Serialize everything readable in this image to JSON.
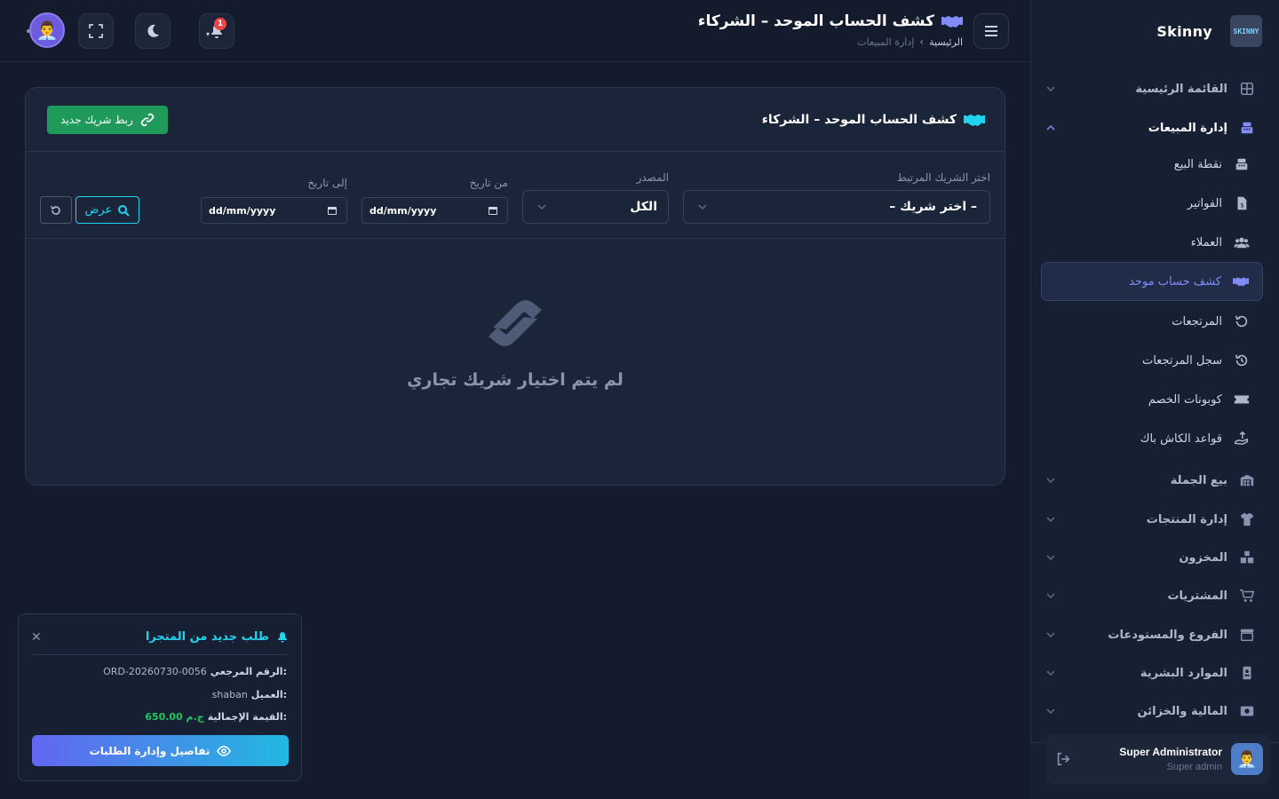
{
  "brand": {
    "name": "Skinny",
    "logo_text": "SKINNY"
  },
  "header": {
    "title": "كشف الحساب الموحد – الشركاء",
    "breadcrumb": {
      "home": "الرئيسية",
      "separator": "‹",
      "current": "إدارة المبيعات"
    },
    "notifications_count": "1"
  },
  "sidebar": {
    "items": [
      {
        "label": "القائمة الرئيسية",
        "icon": "grid-icon"
      },
      {
        "label": "إدارة المبيعات",
        "icon": "cash-register-icon"
      },
      {
        "label": "بيع الجملة",
        "icon": "warehouse-icon"
      },
      {
        "label": "إدارة المنتجات",
        "icon": "shirt-icon"
      },
      {
        "label": "المخزون",
        "icon": "boxes-icon"
      },
      {
        "label": "المشتريات",
        "icon": "cart-icon"
      },
      {
        "label": "الفروع والمستودعات",
        "icon": "store-icon"
      },
      {
        "label": "الموارد البشرية",
        "icon": "id-badge-icon"
      },
      {
        "label": "المالية والخزائن",
        "icon": "money-icon"
      }
    ],
    "sales_sub": [
      {
        "label": "نقطة البيع",
        "icon": "cash-register-icon"
      },
      {
        "label": "الفواتير",
        "icon": "invoice-icon"
      },
      {
        "label": "العملاء",
        "icon": "users-icon"
      },
      {
        "label": "كشف حساب موحد",
        "icon": "handshake-icon"
      },
      {
        "label": "المرتجعات",
        "icon": "undo-icon"
      },
      {
        "label": "سجل المرتجعات",
        "icon": "history-icon"
      },
      {
        "label": "كوبونات الخصم",
        "icon": "ticket-icon"
      },
      {
        "label": "قواعد الكاش باك",
        "icon": "hand-coin-icon"
      }
    ],
    "user": {
      "name": "Super Administrator",
      "role": "Super admin"
    }
  },
  "card": {
    "title": "كشف الحساب الموحد – الشركاء",
    "link_button": "ربط شريك جديد",
    "filters": {
      "partner_label": "اختر الشريك المرتبط",
      "partner_value": "– اختر شريك –",
      "source_label": "المصدر",
      "source_value": "الكل",
      "from_label": "من تاريخ",
      "from_placeholder": "dd/mm/yyyy",
      "to_label": "إلى تاريخ",
      "to_placeholder": "dd/mm/yyyy",
      "view_button": "عرض"
    },
    "empty_text": "لم يتم اختيار شريك تجاري"
  },
  "toast": {
    "title": "طلب جديد من المتجرا",
    "ref_label": "الرقم المرجعي:",
    "ref_value": "ORD-20260730-0056",
    "customer_label": "العميل:",
    "customer_value": "shaban",
    "total_label": "القيمة الإجمالية:",
    "total_value": "650.00 ج.م",
    "button": "تفاصيل وإدارة الطلبات"
  },
  "colors": {
    "accent": "#818cf8",
    "cyan": "#22d3ee",
    "success": "#1f9a5a",
    "bg": "#131b2c"
  }
}
